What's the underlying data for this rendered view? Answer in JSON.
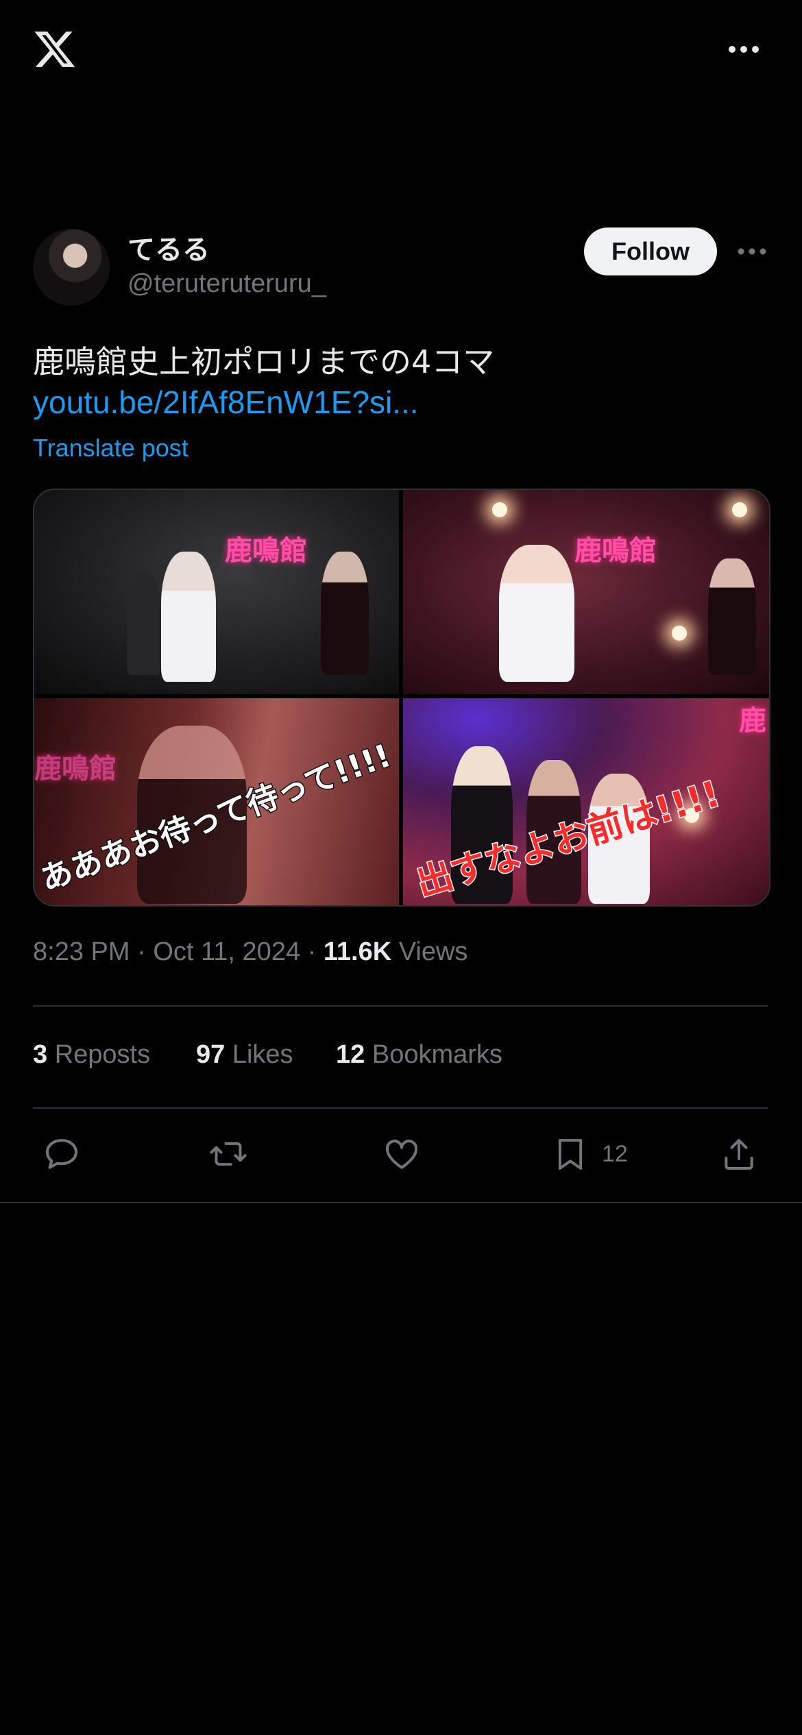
{
  "header": {
    "logo_icon": "x-logo-icon",
    "more_icon": "more-horizontal-icon"
  },
  "author": {
    "display_name": "てるる",
    "handle": "@teruteruteruru_",
    "follow_label": "Follow"
  },
  "post": {
    "text": "鹿鳴館史上初ポロリまでの4コマ",
    "link": "youtu.be/2IfAf8EnW1E?si...",
    "translate_label": "Translate post"
  },
  "media": {
    "tile_1": {
      "neon_sign": "鹿鳴館"
    },
    "tile_2": {
      "neon_sign": "鹿鳴館"
    },
    "tile_3": {
      "neon_sign": "鹿鳴館",
      "caption": "あああお待って待って!!!!"
    },
    "tile_4": {
      "neon_sign": "鹿",
      "caption": "出すなよお前は!!!!"
    }
  },
  "meta": {
    "time": "8:23 PM",
    "date": "Oct 11, 2024",
    "views_count": "11.6K",
    "views_label": "Views"
  },
  "stats": {
    "reposts_count": "3",
    "reposts_label": "Reposts",
    "likes_count": "97",
    "likes_label": "Likes",
    "bookmarks_count": "12",
    "bookmarks_label": "Bookmarks"
  },
  "actions": {
    "bookmark_count": "12",
    "icons": [
      "reply-icon",
      "repost-icon",
      "like-icon",
      "bookmark-icon",
      "share-icon"
    ]
  },
  "colors": {
    "accent": "#1d9bf0",
    "muted": "#71767b",
    "text": "#e7e9ea",
    "border": "#2f3336"
  }
}
